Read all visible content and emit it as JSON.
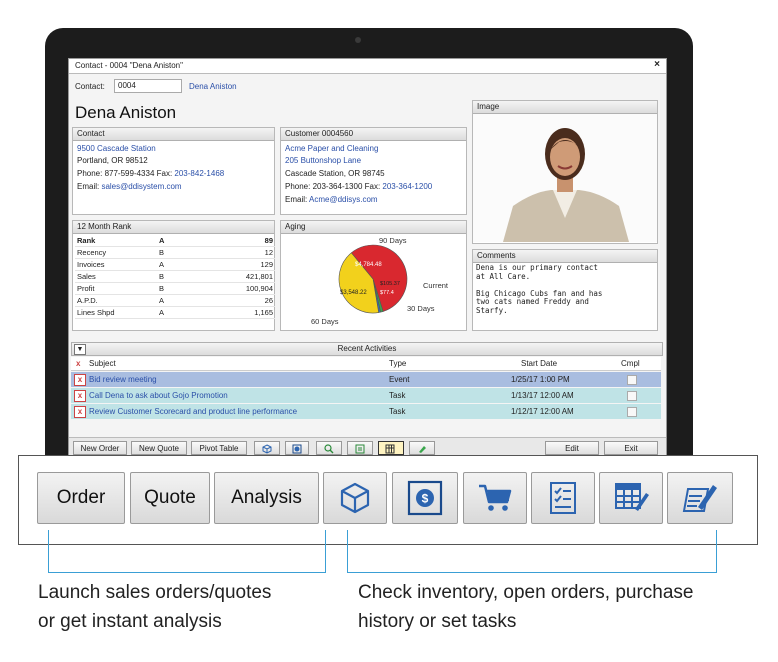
{
  "window": {
    "title": "Contact - 0004 \"Dena Aniston\"",
    "close": "×"
  },
  "contact_field": {
    "label": "Contact:",
    "value": "0004",
    "link": "Dena Aniston"
  },
  "name_heading": "Dena Aniston",
  "contact_panel": {
    "header": "Contact",
    "address1": "9500 Cascade Station",
    "address2": "Portland, OR 98512",
    "phone_prefix": "Phone: 877-599-4334  Fax: ",
    "fax": "203-842-1468",
    "email_prefix": "Email: ",
    "email": "sales@ddisystem.com"
  },
  "customer_panel": {
    "header": "Customer 0004560",
    "company": "Acme Paper and Cleaning",
    "address1": "205 Buttonshop Lane",
    "address2": "Cascade Station, OR 98745",
    "phone_prefix": "Phone: 203-364-1300  Fax: ",
    "fax": "203-364-1200",
    "email_prefix": "Email: ",
    "email": "Acme@ddisys.com"
  },
  "image_panel": {
    "header": "Image"
  },
  "comments_panel": {
    "header": "Comments",
    "lines": [
      "Dena is our primary contact",
      "at All Care.",
      "",
      "Big Chicago Cubs fan and has",
      "two cats named Freddy and",
      "Starfy."
    ]
  },
  "rank_panel": {
    "header": "12 Month Rank",
    "rows": [
      [
        "Rank",
        "A",
        "89"
      ],
      [
        "Recency",
        "B",
        "12"
      ],
      [
        "Invoices",
        "A",
        "129"
      ],
      [
        "Sales",
        "B",
        "421,801"
      ],
      [
        "Profit",
        "B",
        "100,904"
      ],
      [
        "A.P.D.",
        "A",
        "26"
      ],
      [
        "Lines Shpd",
        "A",
        "1,165"
      ]
    ]
  },
  "aging_panel": {
    "header": "Aging",
    "labels": {
      "days90": "90 Days",
      "current": "Current",
      "days30": "30 Days",
      "days60": "60 Days"
    },
    "slice_labels": {
      "red": "$4,784.48",
      "green": "$105.37",
      "yellow": "$3,548.22",
      "blue": "$77.4"
    }
  },
  "chart_data": {
    "type": "pie",
    "series": [
      {
        "name": "90 Days",
        "value": 4784.48,
        "color": "#d9282f"
      },
      {
        "name": "Current",
        "value": 105.37,
        "color": "#3aa64c"
      },
      {
        "name": "30 Days",
        "value": 77.4,
        "color": "#2f6fc0"
      },
      {
        "name": "60 Days",
        "value": 3548.22,
        "color": "#f2d11c"
      }
    ]
  },
  "activities": {
    "header": "Recent Activities",
    "columns": {
      "subject": "Subject",
      "type": "Type",
      "start": "Start Date",
      "cmpl": "Cmpl"
    },
    "rows": [
      {
        "subject": "Bid review meeting",
        "type": "Event",
        "start": "1/25/17 1:00 PM"
      },
      {
        "subject": "Call Dena to ask about Gojo Promotion",
        "type": "Task",
        "start": "1/13/17 12:00 AM"
      },
      {
        "subject": "Review Customer Scorecard and product line performance",
        "type": "Task",
        "start": "1/12/17 12:00 AM"
      }
    ]
  },
  "toolbar": {
    "new_order": "New Order",
    "new_quote": "New Quote",
    "pivot": "Pivot Table",
    "edit": "Edit",
    "exit": "Exit"
  },
  "zoom": {
    "order": "Order",
    "quote": "Quote",
    "analysis": "Analysis"
  },
  "captions": {
    "left_line1": "Launch sales orders/quotes",
    "left_line2": "or get instant analysis",
    "right_line1": "Check inventory, open orders, purchase",
    "right_line2": "history or set tasks"
  },
  "colors": {
    "accent_blue": "#3a9fd5",
    "link": "#2a4fa8",
    "row_blue": "#a9bde0",
    "row_teal": "#bfe3e6"
  }
}
